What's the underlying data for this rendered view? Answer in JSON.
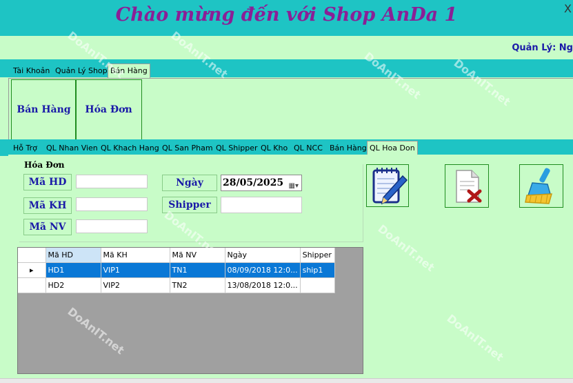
{
  "app": {
    "title": "Chào mừng đến với Shop AnDa 1",
    "close_glyph": "X",
    "manager_label": "Quản Lý: Ng"
  },
  "top_tabs": [
    "Tài Khoản",
    "Quản Lý Shop",
    "Bán Hàng"
  ],
  "top_active_tab": "Bán Hàng",
  "top_panel": {
    "sales_button": "Bán Hàng",
    "invoice_button": "Hóa Đơn"
  },
  "sub_tabs": [
    "Hỗ Trợ",
    "QL Nhan Vien",
    "QL Khach Hang",
    "QL San Pham",
    "QL Shipper",
    "QL Kho",
    "QL NCC",
    "Bán Hàng",
    "QL Hoa Don"
  ],
  "sub_active_tab": "QL Hoa Don",
  "invoice_form": {
    "group_title": "Hóa Đơn",
    "ma_hd_label": "Mã HD",
    "ma_kh_label": "Mã KH",
    "ma_nv_label": "Mã NV",
    "ngay_label": "Ngày",
    "shipper_label": "Shipper",
    "ma_hd_value": "",
    "ma_kh_value": "",
    "ma_nv_value": "",
    "shipper_value": "",
    "ngay_value": "28/05/2025"
  },
  "icons": {
    "edit": "notepad-pen-icon",
    "delete": "document-delete-icon",
    "clear": "broom-icon",
    "calendar": "calendar-icon"
  },
  "table": {
    "columns": [
      "Mã HD",
      "Mã KH",
      "Mã NV",
      "Ngày",
      "Shipper"
    ],
    "rows": [
      [
        "HD1",
        "VIP1",
        "TN1",
        "08/09/2018 12:0...",
        "ship1"
      ],
      [
        "HD2",
        "VIP2",
        "TN2",
        "13/08/2018 12:0...",
        ""
      ]
    ],
    "selected_row": 0,
    "row_indicator": "▸"
  },
  "watermark": "DoAnIT.net",
  "colors": {
    "header_bg": "#1ec4c4",
    "panel_bg": "#c8fcc8",
    "title_color": "#8a1f96",
    "label_color": "#1a1aa8",
    "selected_row": "#0a78d6"
  }
}
